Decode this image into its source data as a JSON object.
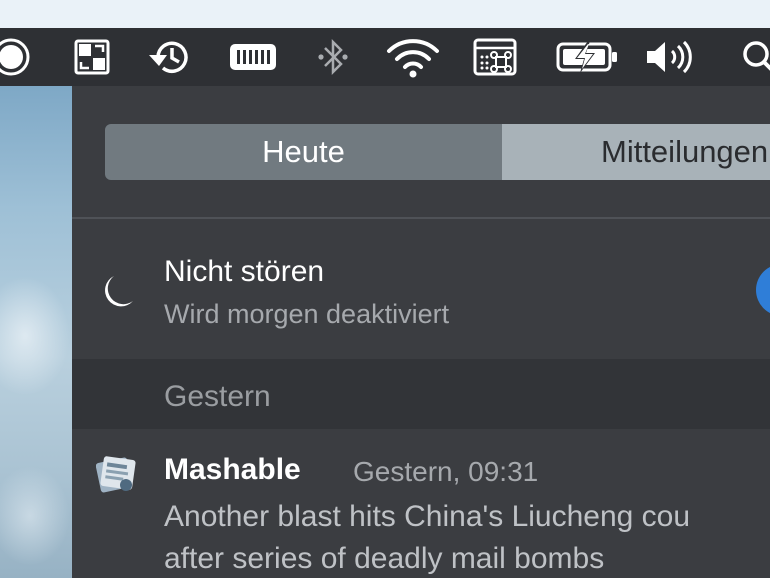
{
  "menubar": {
    "icons": [
      "sync-status-icon",
      "cast-icon",
      "time-machine-icon",
      "memory-monitor-icon",
      "bluetooth-icon",
      "wifi-icon",
      "keyboard-shortcut-icon",
      "battery-charging-icon",
      "volume-icon",
      "spotlight-search-icon"
    ]
  },
  "notification_center": {
    "tabs": [
      {
        "label": "Heute",
        "selected": true
      },
      {
        "label": "Mitteilungen",
        "selected": false
      }
    ],
    "do_not_disturb": {
      "title": "Nicht stören",
      "subtitle": "Wird morgen deaktiviert",
      "enabled": true
    },
    "sections": [
      {
        "title": "Gestern",
        "notifications": [
          {
            "app": "Mashable",
            "time": "Gestern, 09:31",
            "body_lines": [
              "Another blast hits China's Liucheng cou",
              "after series of deadly mail bombs"
            ]
          }
        ]
      }
    ]
  },
  "colors": {
    "menubar_bg": "#2e3034",
    "panel_bg": "#3b3d41",
    "section_header_bg": "#323438",
    "tab_selected_bg": "#717a80",
    "tab_unselected_bg": "#a8b2b8",
    "toggle_on": "#2f7ed8"
  }
}
